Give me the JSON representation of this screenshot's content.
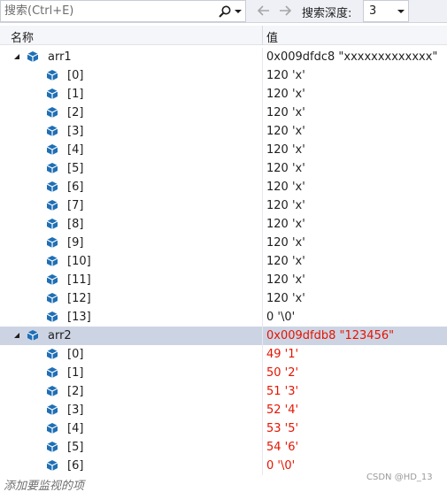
{
  "toolbar": {
    "search_placeholder": "搜索(Ctrl+E)",
    "depth_label": "搜索深度:",
    "depth_value": "3"
  },
  "columns": {
    "name": "名称",
    "value": "值"
  },
  "rows": [
    {
      "name": "arr1",
      "value": "0x009dfdc8 \"xxxxxxxxxxxxx\"",
      "level": 0,
      "expanded": true,
      "selected": false,
      "changed": false
    },
    {
      "name": "[0]",
      "value": "120 'x'",
      "level": 1,
      "selected": false,
      "changed": false
    },
    {
      "name": "[1]",
      "value": "120 'x'",
      "level": 1,
      "selected": false,
      "changed": false
    },
    {
      "name": "[2]",
      "value": "120 'x'",
      "level": 1,
      "selected": false,
      "changed": false
    },
    {
      "name": "[3]",
      "value": "120 'x'",
      "level": 1,
      "selected": false,
      "changed": false
    },
    {
      "name": "[4]",
      "value": "120 'x'",
      "level": 1,
      "selected": false,
      "changed": false
    },
    {
      "name": "[5]",
      "value": "120 'x'",
      "level": 1,
      "selected": false,
      "changed": false
    },
    {
      "name": "[6]",
      "value": "120 'x'",
      "level": 1,
      "selected": false,
      "changed": false
    },
    {
      "name": "[7]",
      "value": "120 'x'",
      "level": 1,
      "selected": false,
      "changed": false
    },
    {
      "name": "[8]",
      "value": "120 'x'",
      "level": 1,
      "selected": false,
      "changed": false
    },
    {
      "name": "[9]",
      "value": "120 'x'",
      "level": 1,
      "selected": false,
      "changed": false
    },
    {
      "name": "[10]",
      "value": "120 'x'",
      "level": 1,
      "selected": false,
      "changed": false
    },
    {
      "name": "[11]",
      "value": "120 'x'",
      "level": 1,
      "selected": false,
      "changed": false
    },
    {
      "name": "[12]",
      "value": "120 'x'",
      "level": 1,
      "selected": false,
      "changed": false
    },
    {
      "name": "[13]",
      "value": "0 '\\0'",
      "level": 1,
      "selected": false,
      "changed": false
    },
    {
      "name": "arr2",
      "value": "0x009dfdb8 \"123456\"",
      "level": 0,
      "expanded": true,
      "selected": true,
      "changed": true
    },
    {
      "name": "[0]",
      "value": "49 '1'",
      "level": 1,
      "selected": false,
      "changed": true
    },
    {
      "name": "[1]",
      "value": "50 '2'",
      "level": 1,
      "selected": false,
      "changed": true
    },
    {
      "name": "[2]",
      "value": "51 '3'",
      "level": 1,
      "selected": false,
      "changed": true
    },
    {
      "name": "[3]",
      "value": "52 '4'",
      "level": 1,
      "selected": false,
      "changed": true
    },
    {
      "name": "[4]",
      "value": "53 '5'",
      "level": 1,
      "selected": false,
      "changed": true
    },
    {
      "name": "[5]",
      "value": "54 '6'",
      "level": 1,
      "selected": false,
      "changed": true
    },
    {
      "name": "[6]",
      "value": "0 '\\0'",
      "level": 1,
      "selected": false,
      "changed": true
    }
  ],
  "add_watch_text": "添加要监视的项",
  "watermark": "CSDN @HD_13",
  "colors": {
    "changed_value": "#e51400",
    "selection": "#ccd4e4",
    "object_icon": "#1f6fb5"
  },
  "icons": {
    "search": "search-icon",
    "back": "arrow-left-icon",
    "forward": "arrow-right-icon",
    "object": "object-cube-icon",
    "expand": "expanded-triangle-icon"
  }
}
